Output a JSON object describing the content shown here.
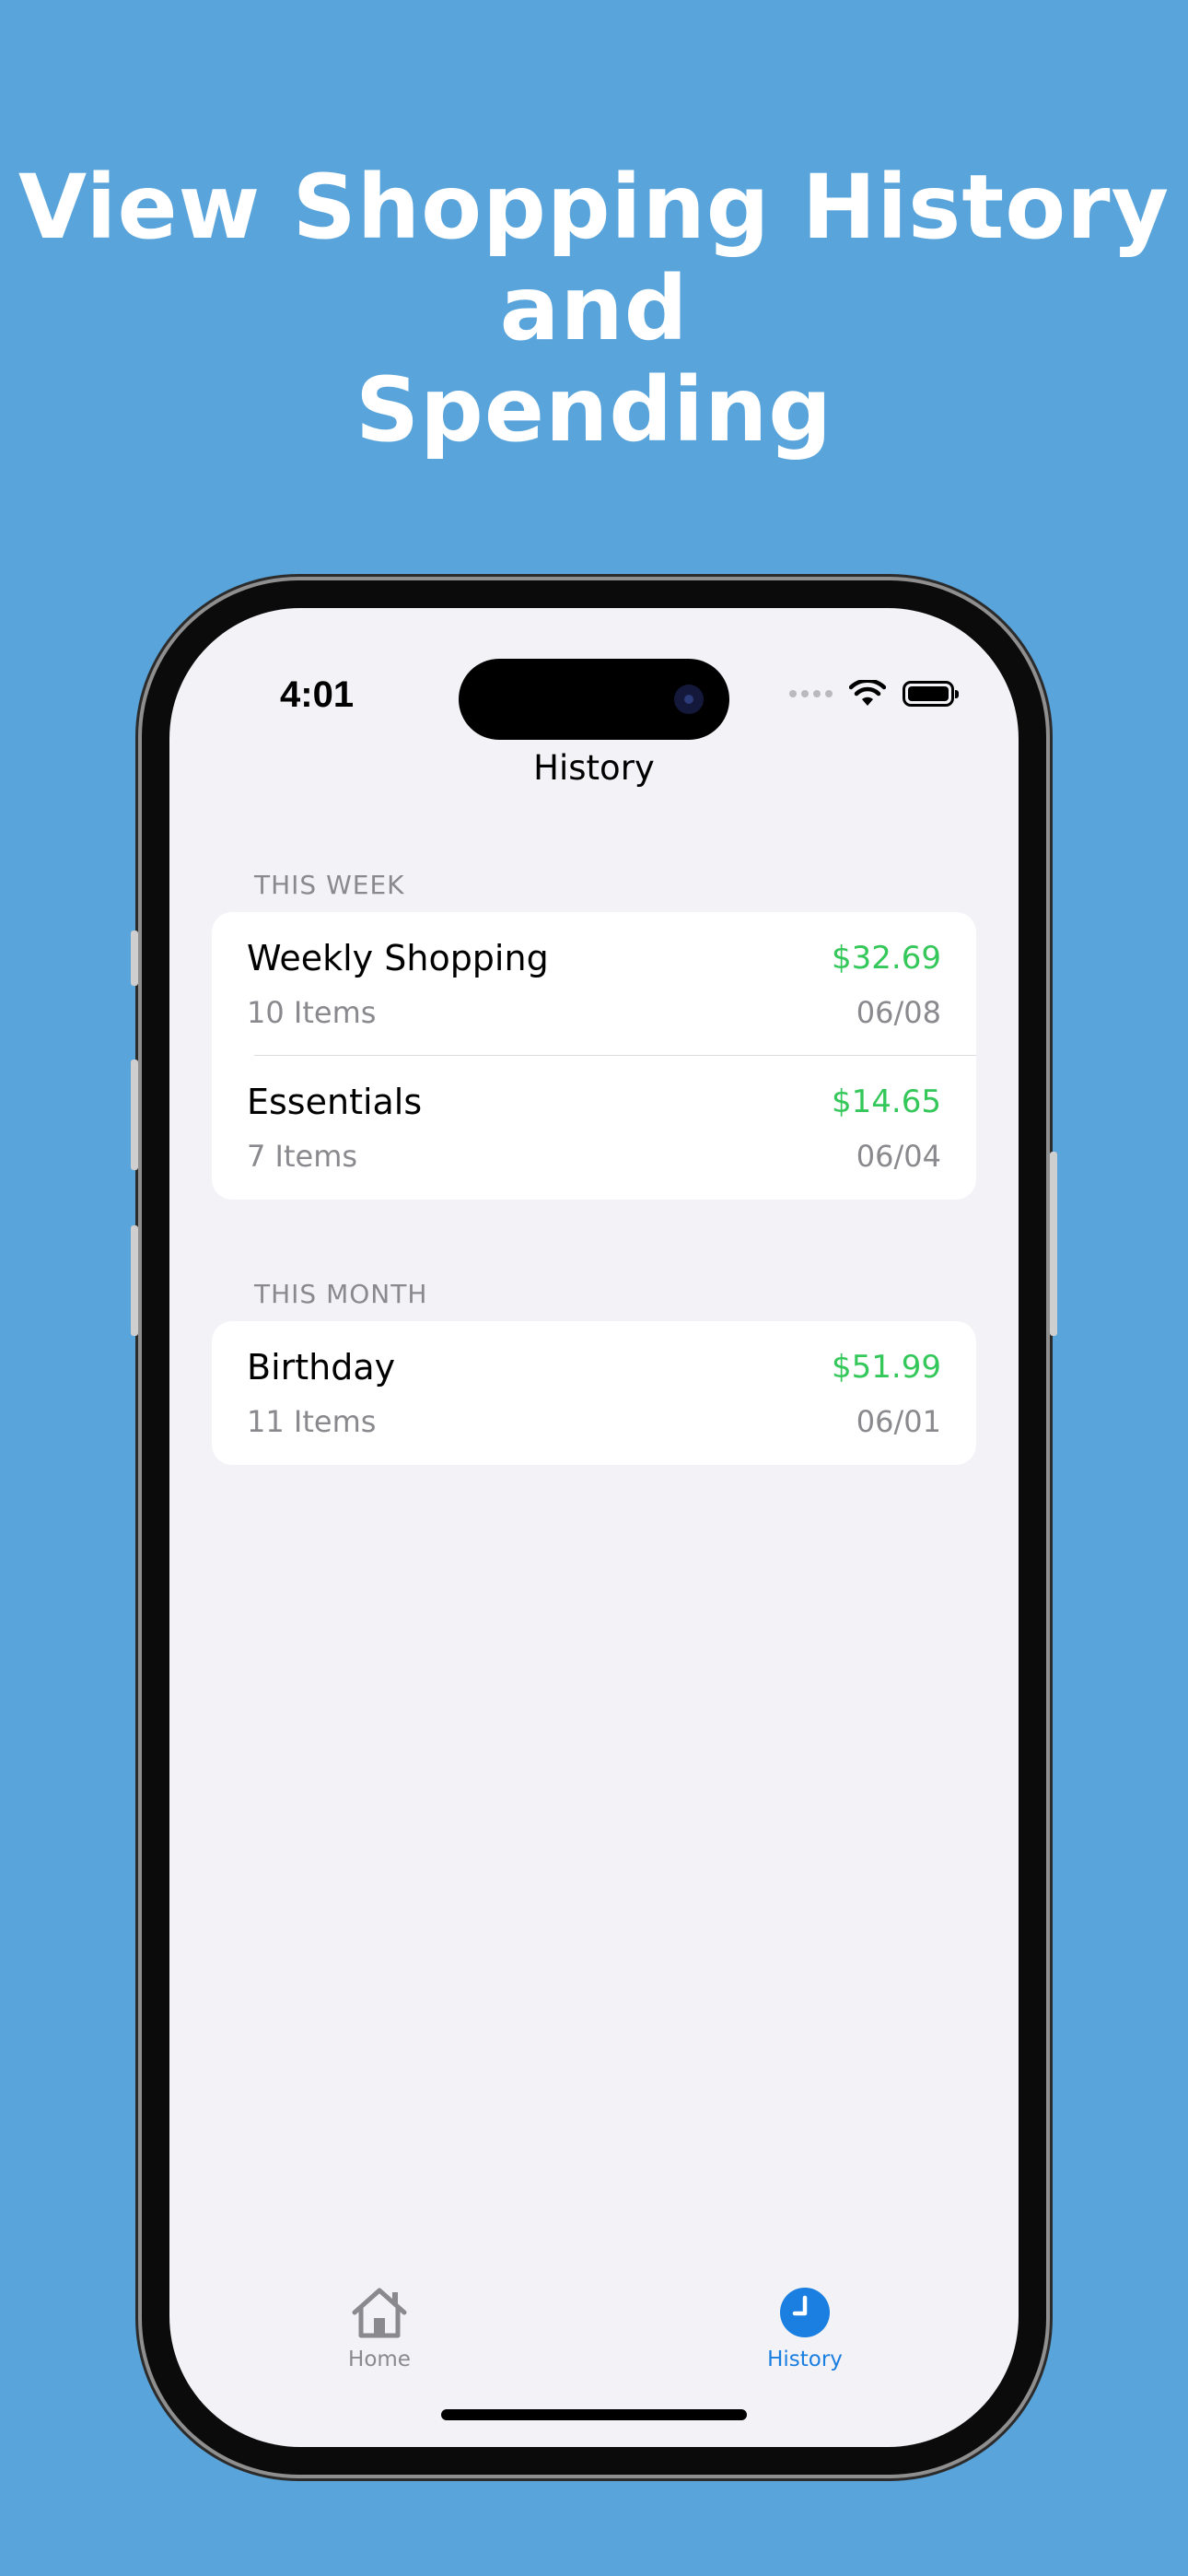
{
  "promo": {
    "headline_line1": "View Shopping History and",
    "headline_line2": "Spending"
  },
  "status_bar": {
    "time": "4:01"
  },
  "nav": {
    "title": "History"
  },
  "sections": [
    {
      "header": "THIS WEEK",
      "items": [
        {
          "name": "Weekly Shopping",
          "amount": "$32.69",
          "count": "10 Items",
          "date": "06/08"
        },
        {
          "name": "Essentials",
          "amount": "$14.65",
          "count": "7 Items",
          "date": "06/04"
        }
      ]
    },
    {
      "header": "THIS MONTH",
      "items": [
        {
          "name": "Birthday",
          "amount": "$51.99",
          "count": "11 Items",
          "date": "06/01"
        }
      ]
    }
  ],
  "tab_bar": {
    "home_label": "Home",
    "history_label": "History",
    "active": "History"
  },
  "colors": {
    "background": "#59a4db",
    "accent": "#1a7fe0",
    "amount": "#34c759"
  },
  "icons": {
    "home": "house-icon",
    "history": "clock-icon"
  }
}
